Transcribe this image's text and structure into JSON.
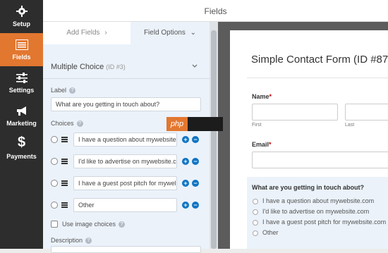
{
  "nav": {
    "items": [
      {
        "label": "Setup",
        "icon": "gear-icon"
      },
      {
        "label": "Fields",
        "icon": "list-icon"
      },
      {
        "label": "Settings",
        "icon": "sliders-icon"
      },
      {
        "label": "Marketing",
        "icon": "megaphone-icon"
      },
      {
        "label": "Payments",
        "icon": "dollar-icon"
      }
    ],
    "active_color": "#e27730"
  },
  "topbar": {
    "title": "Fields"
  },
  "panel": {
    "tab_add": "Add Fields",
    "tab_add_arrow": "›",
    "tab_options": "Field Options",
    "tab_options_arrow": "⌄",
    "field_name": "Multiple Choice",
    "field_id": "(ID #3)",
    "label_title": "Label",
    "label_value": "What are you getting in touch about?",
    "choices_title": "Choices",
    "choices": [
      "I have a question about mywebsite",
      "I'd like to advertise on mywebsite.c",
      "I have a guest post pitch for mywel",
      "Other"
    ],
    "image_choices": "Use image choices",
    "description_title": "Description"
  },
  "preview": {
    "form_title": "Simple Contact Form (ID #87",
    "name_label": "Name",
    "first_label": "First",
    "last_label": "Last",
    "email_label": "Email",
    "required_mark": "*",
    "question": "What are you getting in touch about?",
    "options": [
      "I have a question about mywebsite.com",
      "I'd like to advertise on mywebsite.com",
      "I have a guest post pitch for mywebsite.com",
      "Other"
    ]
  },
  "watermark": {
    "text": "php"
  }
}
